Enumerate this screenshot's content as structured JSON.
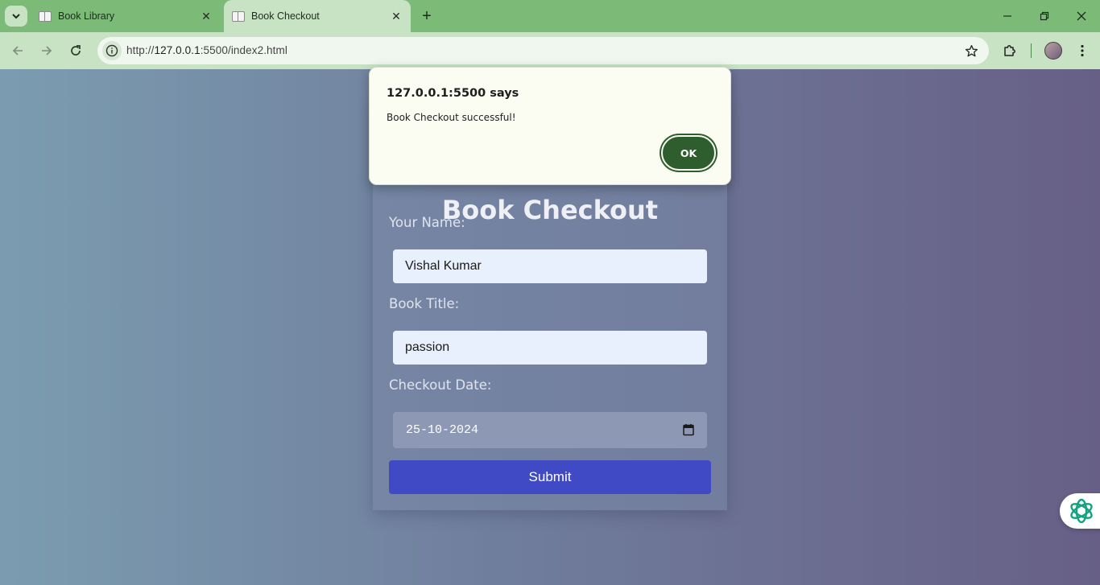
{
  "browser": {
    "tabs": [
      {
        "title": "Book Library",
        "active": false
      },
      {
        "title": "Book Checkout",
        "active": true
      }
    ],
    "url_host": "127.0.0.1",
    "url_prefix": "http://",
    "url_rest": ":5500/index2.html"
  },
  "page": {
    "title": "Book Checkout",
    "name_label": "Your Name:",
    "name_value": "Vishal Kumar",
    "book_label": "Book Title:",
    "book_value": "passion",
    "date_label": "Checkout Date:",
    "date_value": "25-10-2024",
    "submit_label": "Submit"
  },
  "dialog": {
    "title": "127.0.0.1:5500 says",
    "message": "Book Checkout successful!",
    "ok_label": "OK"
  },
  "colors": {
    "tabstrip": "#7bbb77",
    "toolbar": "#c7e3c4",
    "submit": "#3f4ac4",
    "ok_button": "#2e5e2e"
  }
}
